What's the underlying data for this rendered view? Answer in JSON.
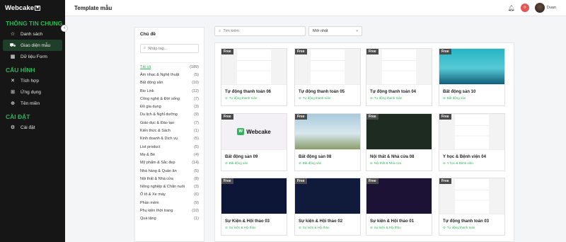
{
  "brand": "Webcake",
  "brand_mark": "✖",
  "sidebar": {
    "sections": [
      {
        "title": "THÔNG TIN CHUNG",
        "items": [
          {
            "label": "Danh sách",
            "icon": "star-icon",
            "glyph": "☆",
            "active": false
          },
          {
            "label": "Giao diện mẫu",
            "icon": "cart-icon",
            "glyph": "⛟",
            "active": true
          },
          {
            "label": "Dữ liệu Form",
            "icon": "form-icon",
            "glyph": "▦",
            "active": false
          }
        ]
      },
      {
        "title": "CẤU HÌNH",
        "items": [
          {
            "label": "Tích hợp",
            "icon": "tools-icon",
            "glyph": "✕",
            "active": false
          },
          {
            "label": "Ứng dụng",
            "icon": "apps-icon",
            "glyph": "⊞",
            "active": false
          },
          {
            "label": "Tên miền",
            "icon": "globe-icon",
            "glyph": "⊕",
            "active": false
          }
        ]
      },
      {
        "title": "CÀI ĐẶT",
        "items": [
          {
            "label": "Cài đặt",
            "icon": "gear-icon",
            "glyph": "⚙",
            "active": false
          }
        ]
      }
    ]
  },
  "header": {
    "title": "Template mẫu",
    "notifications": "0",
    "user_name": "Duan"
  },
  "categories": {
    "title": "Chủ đề",
    "search_placeholder": "Nhập tag...",
    "items": [
      {
        "name": "Tất cả",
        "count": "(189)",
        "active": true
      },
      {
        "name": "Âm nhạc & Nghệ thuật",
        "count": "(5)"
      },
      {
        "name": "Bất động sản",
        "count": "(10)"
      },
      {
        "name": "Bio Link",
        "count": "(12)"
      },
      {
        "name": "Công nghệ & Đời sống",
        "count": "(7)"
      },
      {
        "name": "Đồ gia dụng",
        "count": "(3)"
      },
      {
        "name": "Du lịch & Nghỉ dưỡng",
        "count": "(9)"
      },
      {
        "name": "Giáo dục & Đào tạo",
        "count": "(7)"
      },
      {
        "name": "Kiến thức & Sách",
        "count": "(1)"
      },
      {
        "name": "Kinh doanh & Dịch vụ",
        "count": "(5)"
      },
      {
        "name": "List product",
        "count": "(5)"
      },
      {
        "name": "Mẹ & Bé",
        "count": "(4)"
      },
      {
        "name": "Mỹ phẩm & Sắc đẹp",
        "count": "(14)"
      },
      {
        "name": "Nhà hàng & Quán ăn",
        "count": "(5)"
      },
      {
        "name": "Nội thất & Nhà cửa",
        "count": "(8)"
      },
      {
        "name": "Nông nghiệp & Chăn nuôi",
        "count": "(3)"
      },
      {
        "name": "Ô tô & Xe máy",
        "count": "(6)"
      },
      {
        "name": "Phần mềm",
        "count": "(9)"
      },
      {
        "name": "Phụ kiện thời trang",
        "count": "(10)"
      },
      {
        "name": "Quà tặng",
        "count": "(1)"
      }
    ]
  },
  "filters": {
    "search_placeholder": "Tìm kiếm",
    "sort_value": "Mới nhất"
  },
  "templates": [
    {
      "badge": "Free",
      "title": "Tự động thanh toán 06",
      "tag": "Tự động thanh toán",
      "thumb": "t-white"
    },
    {
      "badge": "Free",
      "title": "Tự động thanh toán 05",
      "tag": "Tự động thanh toán",
      "thumb": "t-white"
    },
    {
      "badge": "Free",
      "title": "Tự động thanh toán 04",
      "tag": "Tự động thanh toán",
      "thumb": "t-white"
    },
    {
      "badge": "Free",
      "title": "Bất động sản 10",
      "tag": "Bất động sản",
      "thumb": "t-teal"
    },
    {
      "badge": "Free",
      "title": "Bất động sản 09",
      "tag": "Bất động sản",
      "thumb": "t-logo"
    },
    {
      "badge": "Free",
      "title": "Bất động sản 08",
      "tag": "Bất động sản",
      "thumb": "t-build"
    },
    {
      "badge": "Free",
      "title": "Nội thất & Nhà cửa 08",
      "tag": "Nội thất & Nhà cửa",
      "thumb": "t-dark"
    },
    {
      "badge": "Free",
      "title": "Y học & Bệnh viện 04",
      "tag": "Y học & Bệnh viện",
      "thumb": "t-white"
    },
    {
      "badge": "Free",
      "title": "Sự Kiện & Hội thảo 03",
      "tag": "Sự kiện & Hội thảo",
      "thumb": "t-dblue"
    },
    {
      "badge": "Free",
      "title": "Sự kiện & Hội thảo 02",
      "tag": "Sự kiện & Hội thảo",
      "thumb": "t-navy"
    },
    {
      "badge": "Free",
      "title": "Sự kiện & Hội thảo 01",
      "tag": "Sự kiện & Hội thảo",
      "thumb": "t-event"
    },
    {
      "badge": "Free",
      "title": "Tự động thanh toán 03",
      "tag": "Tự động thanh toán",
      "thumb": "t-white"
    }
  ],
  "colors": {
    "accent": "#2fb45a",
    "sidebar_bg": "#161616",
    "badge_bg": "#4a4a4a",
    "notif": "#e55353"
  }
}
